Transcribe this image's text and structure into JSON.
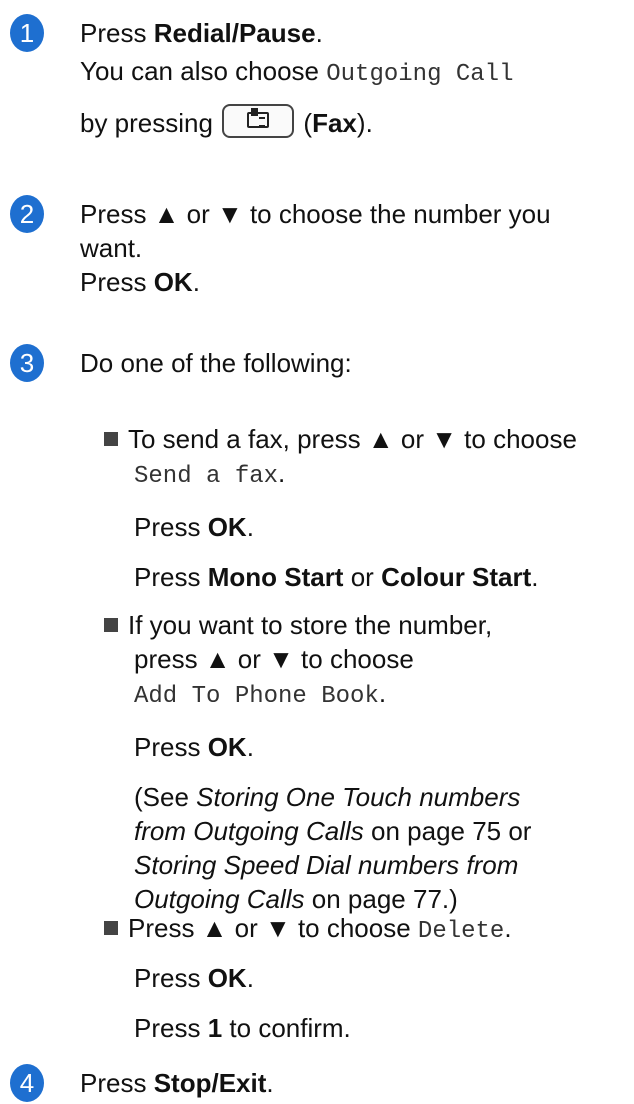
{
  "steps": [
    {
      "number": "1",
      "press": "Press",
      "redial_pause": "Redial/Pause",
      "also_choose": "You can also choose",
      "outgoing_call": "Outgoing Call",
      "by_pressing": "by pressing",
      "fax": "Fax",
      "fax_key_icon": "fax-key-icon"
    },
    {
      "number": "2",
      "line1": "Press ▲ or ▼ to choose the number you",
      "line2": "want.",
      "press": "Press",
      "ok": "OK"
    },
    {
      "number": "3",
      "intro": "Do one of the following:",
      "option1": {
        "line1": "To send a fax, press ▲ or ▼ to choose",
        "send_a_fax": "Send a fax",
        "press": "Press",
        "ok": "OK",
        "mono_start": "Mono Start",
        "or": "or",
        "colour_start": "Colour Start"
      },
      "option2": {
        "line1": "If you want to store the number,",
        "line2": "press ▲ or ▼ to choose",
        "add_to_phone_book": "Add To Phone Book",
        "press": "Press",
        "ok": "OK",
        "see": "(See",
        "ref1_a": "Storing One Touch numbers",
        "ref1_b": "from Outgoing Calls",
        "on_page_75_or": "on page 75 or",
        "ref2_a": "Storing Speed Dial numbers from",
        "ref2_b": "Outgoing Calls",
        "on_page_77": "on page 77.)"
      },
      "option3": {
        "line1": "Press ▲ or ▼ to choose",
        "delete": "Delete",
        "press": "Press",
        "ok": "OK",
        "one": "1",
        "to_confirm": "to confirm."
      }
    },
    {
      "number": "4",
      "press": "Press",
      "stop_exit": "Stop/Exit"
    }
  ],
  "colors": {
    "step_badge": "#1e6fd0"
  }
}
